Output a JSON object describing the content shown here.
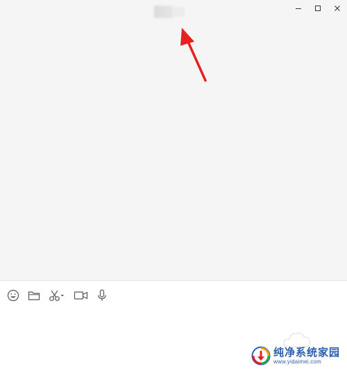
{
  "window": {
    "title": "",
    "controls": {
      "minimize_icon": "minimize-icon",
      "maximize_icon": "maximize-icon",
      "close_icon": "close-icon"
    }
  },
  "annotation": {
    "arrow_color": "#e8201d"
  },
  "toolbar": {
    "items": [
      {
        "icon": "emoji-icon"
      },
      {
        "icon": "folder-icon"
      },
      {
        "icon": "scissors-icon"
      },
      {
        "icon": "video-call-icon"
      },
      {
        "icon": "microphone-icon"
      }
    ]
  },
  "watermark": {
    "title": "纯净系统家园",
    "url": "www.yidaimei.com",
    "color": "#2b5fae"
  }
}
